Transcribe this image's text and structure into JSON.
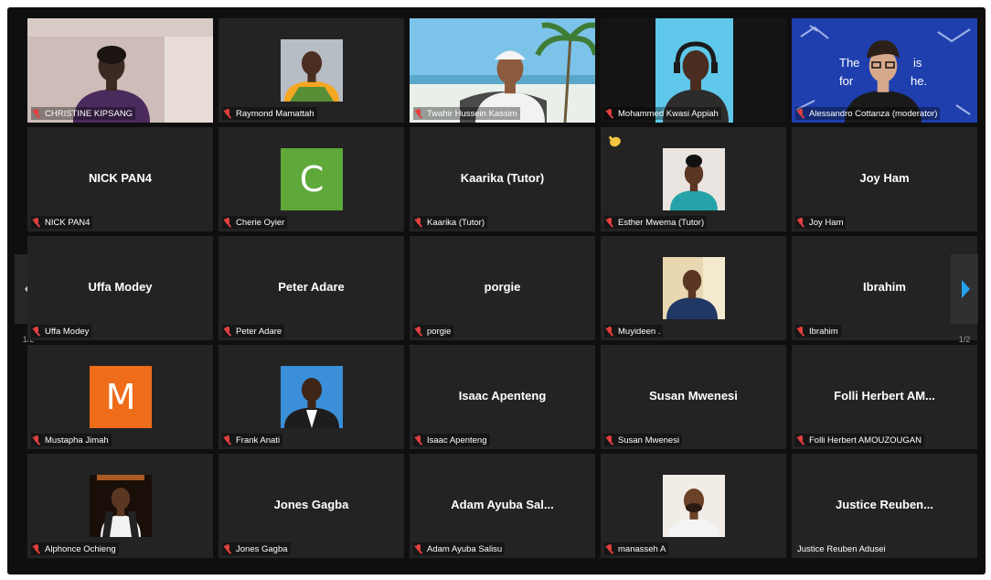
{
  "pagination": {
    "left": "1/2",
    "right": "1/2"
  },
  "participants": [
    {
      "label": "CHRISTINE KIPSANG",
      "kind": "video"
    },
    {
      "label": "Raymond Mamattah",
      "kind": "photo"
    },
    {
      "label": "Twahir Hussein Kassim",
      "kind": "video"
    },
    {
      "label": "Mohammed Kwasi Appiah",
      "kind": "video",
      "active": true
    },
    {
      "label": "Alessandro Cottanza (moderator)",
      "kind": "video",
      "bg_text_1": "The",
      "bg_text_2": "is",
      "bg_text_3": "for",
      "bg_text_4": "he."
    },
    {
      "display": "NICK PAN4",
      "label": "NICK PAN4",
      "kind": "name"
    },
    {
      "label": "Cherie Oyier",
      "kind": "letter",
      "letter": "C",
      "color": "#5fa83a"
    },
    {
      "display": "Kaarika (Tutor)",
      "label": "Kaarika (Tutor)",
      "kind": "name"
    },
    {
      "label": "Esther Mwema (Tutor)",
      "kind": "photo",
      "hand_raised": true
    },
    {
      "display": "Joy Ham",
      "label": "Joy Ham",
      "kind": "name"
    },
    {
      "display": "Uffa Modey",
      "label": "Uffa Modey",
      "kind": "name"
    },
    {
      "display": "Peter Adare",
      "label": "Peter Adare",
      "kind": "name"
    },
    {
      "display": "porgie",
      "label": "porgie",
      "kind": "name"
    },
    {
      "label": "Muyideen .",
      "kind": "photo"
    },
    {
      "display": "Ibrahim",
      "label": "Ibrahim",
      "kind": "name"
    },
    {
      "label": "Mustapha Jimah",
      "kind": "letter",
      "letter": "M",
      "color": "#ef6c1a"
    },
    {
      "label": "Frank Anati",
      "kind": "photo"
    },
    {
      "display": "Isaac Apenteng",
      "label": "Isaac Apenteng",
      "kind": "name"
    },
    {
      "display": "Susan Mwenesi",
      "label": "Susan Mwenesi",
      "kind": "name"
    },
    {
      "display": "Folli Herbert AM...",
      "label": "Folli Herbert AMOUZOUGAN",
      "kind": "name"
    },
    {
      "label": "Alphonce Ochieng",
      "kind": "photo"
    },
    {
      "display": "Jones Gagba",
      "label": "Jones Gagba",
      "kind": "name"
    },
    {
      "display": "Adam Ayuba Sal...",
      "label": "Adam Ayuba Salisu",
      "kind": "name"
    },
    {
      "label": "manasseh A",
      "kind": "photo"
    },
    {
      "display": "Justice Reuben...",
      "label": "Justice Reuben Adusei",
      "kind": "name",
      "unmuted": true
    }
  ],
  "icons": {
    "mic_muted": "mic-muted-icon",
    "raised_hand": "raised-hand-icon",
    "prev_page": "chevron-left-icon",
    "next_page": "chevron-right-icon"
  }
}
